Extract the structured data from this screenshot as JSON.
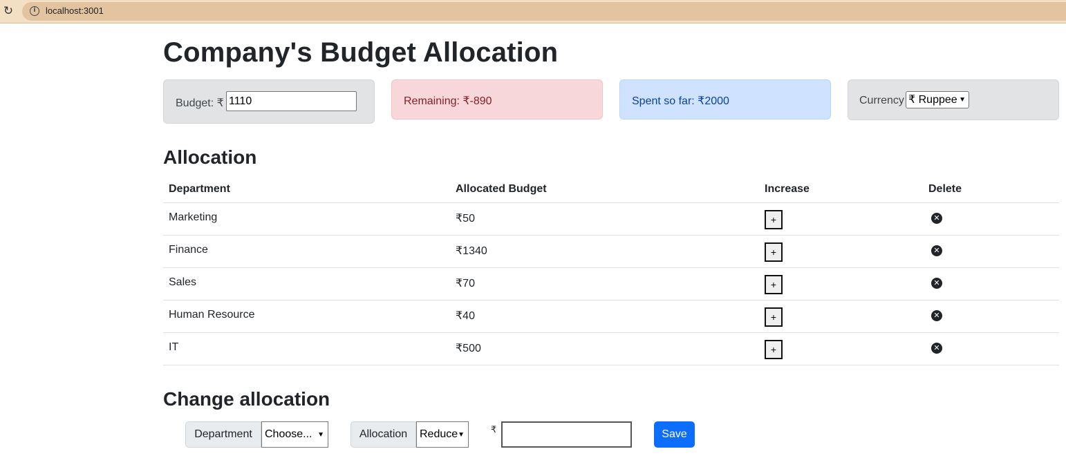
{
  "browser": {
    "reload_glyph": "↻",
    "info_glyph": "i",
    "url": "localhost:3001"
  },
  "page_title": "Company's Budget Allocation",
  "cards": {
    "budget_label": "Budget: ₹",
    "budget_value": "1110",
    "remaining": "Remaining: ₹-890",
    "spent": "Spent so far: ₹2000",
    "currency_label": "Currency",
    "currency_selected": "₹ Ruppee"
  },
  "allocation": {
    "title": "Allocation",
    "headers": {
      "department": "Department",
      "allocated": "Allocated Budget",
      "increase": "Increase",
      "delete": "Delete"
    },
    "rows": [
      {
        "department": "Marketing",
        "budget": "₹50"
      },
      {
        "department": "Finance",
        "budget": "₹1340"
      },
      {
        "department": "Sales",
        "budget": "₹70"
      },
      {
        "department": "Human Resource",
        "budget": "₹40"
      },
      {
        "department": "IT",
        "budget": "₹500"
      }
    ],
    "increase_label": "+",
    "delete_glyph": "✕"
  },
  "change": {
    "title": "Change allocation",
    "department_label": "Department",
    "department_selected": "Choose...",
    "allocation_label": "Allocation",
    "allocation_selected": "Reduce",
    "currency_prefix": "₹",
    "amount_value": "",
    "save_label": "Save"
  },
  "colors": {
    "remaining_bg": "#f8d7da",
    "spent_bg": "#cfe2ff",
    "neutral_bg": "#e2e3e5",
    "primary": "#0d6efd"
  }
}
